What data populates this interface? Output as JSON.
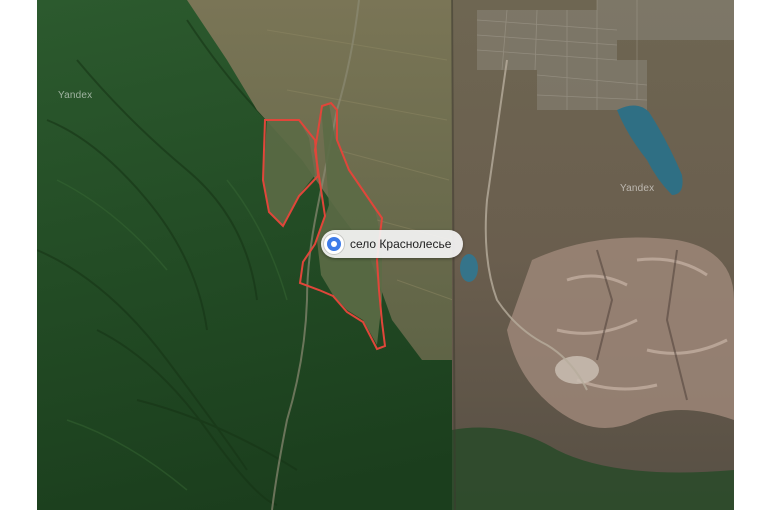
{
  "map": {
    "provider_watermark": "Yandex",
    "place": {
      "label": "село Краснолесье"
    },
    "colors": {
      "boundary": "#e0463a",
      "marker": "#3d7be8",
      "forest": "#1f4a22",
      "steppe": "#6b6a4a",
      "water": "#2f6f84"
    }
  }
}
